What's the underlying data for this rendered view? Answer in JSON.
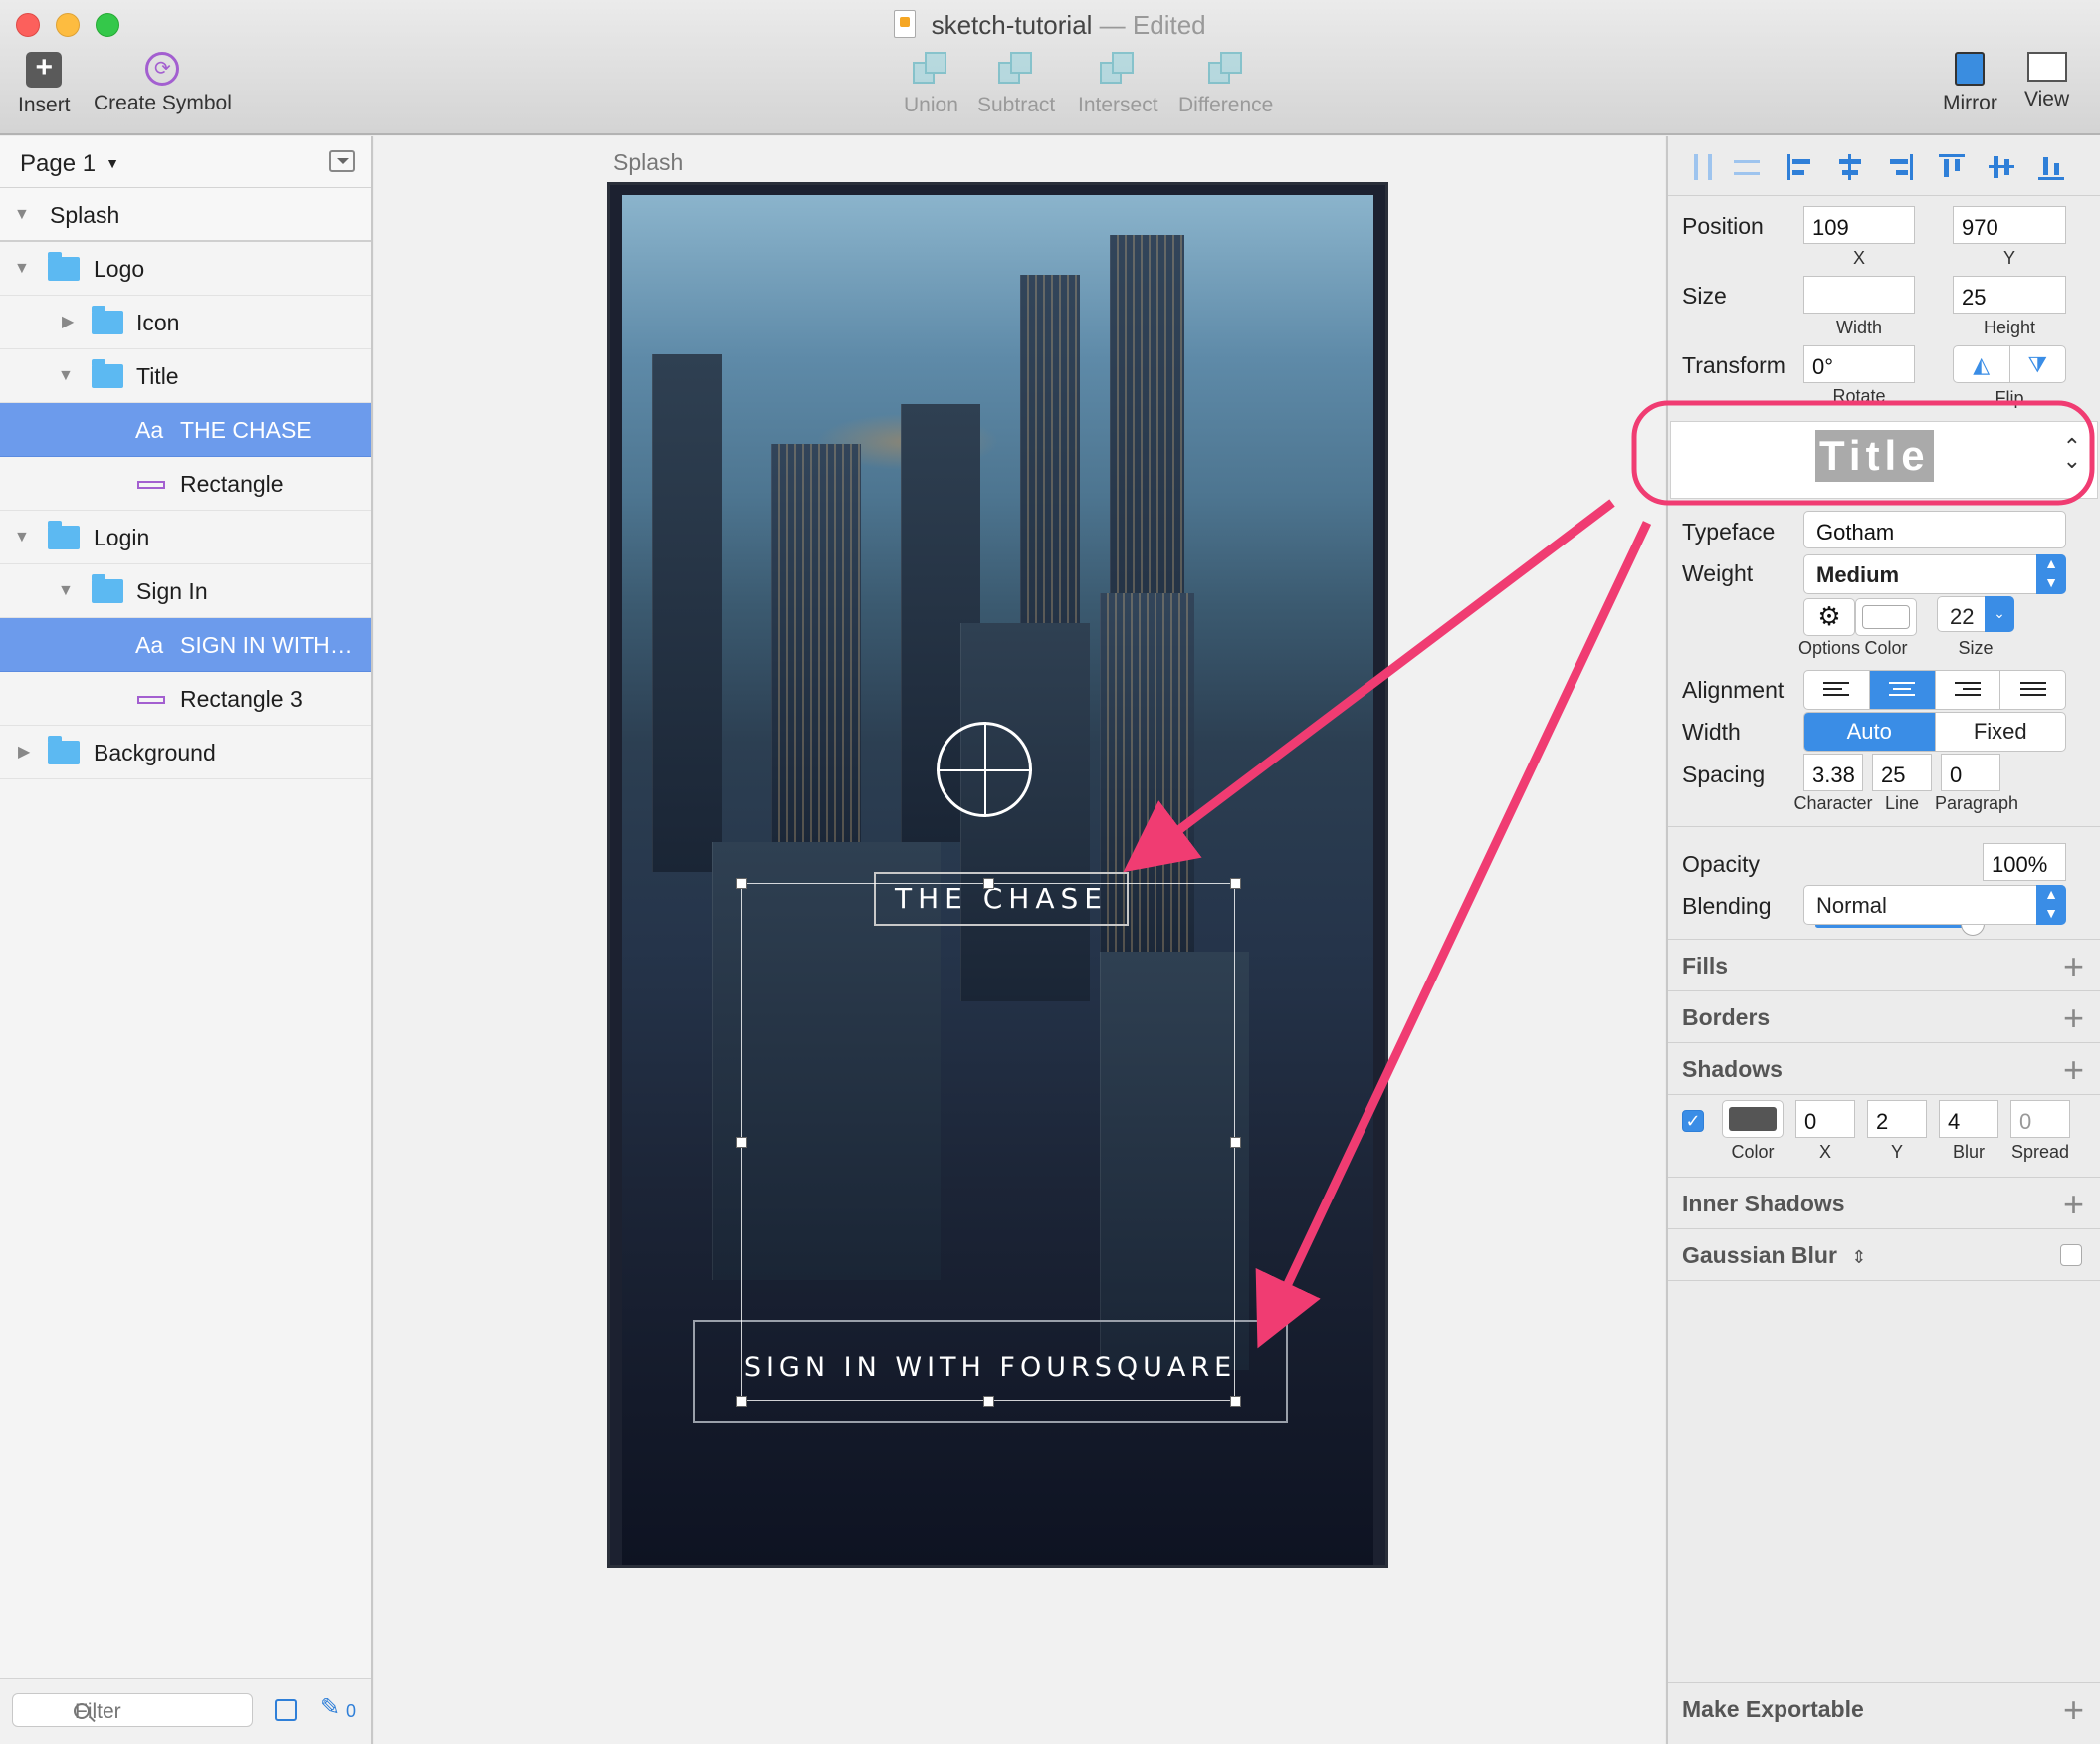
{
  "window": {
    "title": "sketch-tutorial",
    "separator": "—",
    "status": "Edited"
  },
  "toolbar": {
    "insert": "Insert",
    "create_symbol": "Create Symbol",
    "union": "Union",
    "subtract": "Subtract",
    "intersect": "Intersect",
    "difference": "Difference",
    "mirror": "Mirror",
    "view": "View"
  },
  "layers": {
    "page": "Page 1",
    "rows": [
      {
        "label": "Splash"
      },
      {
        "label": "Logo"
      },
      {
        "label": "Icon"
      },
      {
        "label": "Title"
      },
      {
        "label": "THE CHASE",
        "prefix": "Aa"
      },
      {
        "label": "Rectangle"
      },
      {
        "label": "Login"
      },
      {
        "label": "Sign In"
      },
      {
        "label": "SIGN IN WITH…",
        "prefix": "Aa"
      },
      {
        "label": "Rectangle 3"
      },
      {
        "label": "Background"
      }
    ],
    "filter_placeholder": "Filter",
    "edit_count": "0"
  },
  "canvas": {
    "artboard_name": "Splash",
    "title_text": "THE CHASE",
    "signin_text": "SIGN IN WITH FOURSQUARE"
  },
  "inspector": {
    "position": {
      "label": "Position",
      "x": "109",
      "y": "970",
      "x_label": "X",
      "y_label": "Y"
    },
    "size": {
      "label": "Size",
      "width": "",
      "height": "25",
      "width_label": "Width",
      "height_label": "Height"
    },
    "transform": {
      "label": "Transform",
      "rotate": "0°",
      "rotate_label": "Rotate",
      "flip_label": "Flip"
    },
    "text_style": "Title",
    "typeface": {
      "label": "Typeface",
      "value": "Gotham"
    },
    "weight": {
      "label": "Weight",
      "value": "Medium"
    },
    "font_size": "22",
    "options_label": "Options",
    "color_label": "Color",
    "size_label": "Size",
    "alignment": {
      "label": "Alignment",
      "selected": "center"
    },
    "width": {
      "label": "Width",
      "auto": "Auto",
      "fixed": "Fixed"
    },
    "spacing": {
      "label": "Spacing",
      "character": "3.38",
      "line": "25",
      "paragraph": "0",
      "character_label": "Character",
      "line_label": "Line",
      "paragraph_label": "Paragraph"
    },
    "opacity": {
      "label": "Opacity",
      "value": "100%",
      "fraction": 1.0
    },
    "blending": {
      "label": "Blending",
      "value": "Normal"
    },
    "sections": {
      "fills": "Fills",
      "borders": "Borders",
      "shadows": "Shadows",
      "inner_shadows": "Inner Shadows",
      "gaussian_blur": "Gaussian Blur",
      "make_exportable": "Make Exportable"
    },
    "shadow": {
      "x": "0",
      "y": "2",
      "blur": "4",
      "spread": "0",
      "color_label": "Color",
      "x_label": "X",
      "y_label": "Y",
      "blur_label": "Blur",
      "spread_label": "Spread"
    }
  },
  "colors": {
    "accent": "#3a8de6",
    "selection": "#6c9bec",
    "annotation": "#f03c72",
    "symbol": "#a35fd0",
    "folder": "#5cb9f2"
  }
}
